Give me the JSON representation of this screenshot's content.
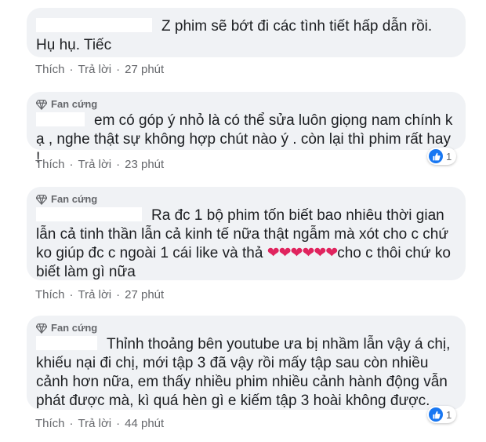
{
  "comments": [
    {
      "badge": "",
      "text": "Z phim sẽ bớt đi các tình tiết hấp dẫn rồi. Hụ hụ. Tiếc",
      "actions": {
        "like": "Thích",
        "reply": "Trả lời",
        "time": "27 phút"
      },
      "reaction": null
    },
    {
      "badge": "Fan cứng",
      "text": "em có góp ý nhỏ là có thể sửa luôn giọng nam chính k ạ , nghe thật sự không hợp chút nào ý . còn lại thì phim rất hay !",
      "actions": {
        "like": "Thích",
        "reply": "Trả lời",
        "time": "23 phút"
      },
      "reaction": {
        "icon": "like-icon",
        "count": "1"
      }
    },
    {
      "badge": "Fan cứng",
      "text_before": "Ra đc 1 bộ phim tốn biết bao nhiêu thời gian lẫn cả tinh thần lẫn cả kinh tế nữa thật ngẫm mà xót cho c chứ ko giúp đc c ngoài 1 cái like và thả",
      "hearts": "❤❤❤❤❤❤",
      "text_after": "cho c thôi chứ ko biết làm gì nữa",
      "actions": {
        "like": "Thích",
        "reply": "Trả lời",
        "time": "27 phút"
      },
      "reaction": null
    },
    {
      "badge": "Fan cứng",
      "text": "Thỉnh thoảng bên youtube ưa bị nhầm lẫn vậy á chị, khiếu nại đi chị, mới tập 3 đã vậy rồi mấy tập sau còn nhiều cảnh hơn nữa, em thấy nhiều phim nhiều cảnh hành động vẫn phát được mà, kì quá hèn gì e kiếm tập 3 hoài không được.",
      "actions": {
        "like": "Thích",
        "reply": "Trả lời",
        "time": "44 phút"
      },
      "reaction": {
        "icon": "like-icon",
        "count": "1"
      }
    }
  ],
  "colors": {
    "bubble": "#f0f2f5",
    "meta": "#65676b",
    "like": "#1877f2",
    "heart": "#e0245e"
  }
}
